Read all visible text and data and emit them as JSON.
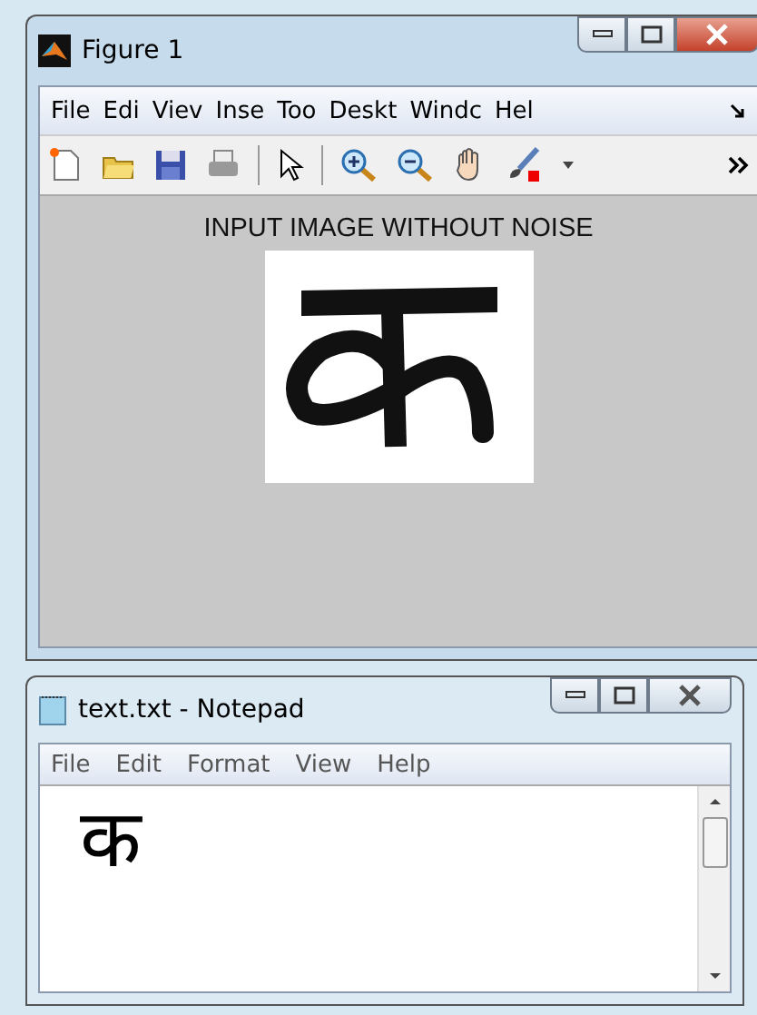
{
  "figure_window": {
    "title": "Figure 1",
    "active": true,
    "menu": [
      "File",
      "Edi",
      "Viev",
      "Inse",
      "Too",
      "Deskt",
      "Windc",
      "Hel"
    ],
    "toolbar": [
      {
        "kind": "new"
      },
      {
        "kind": "open"
      },
      {
        "kind": "save"
      },
      {
        "kind": "print"
      },
      {
        "kind": "sep"
      },
      {
        "kind": "pointer"
      },
      {
        "kind": "sep"
      },
      {
        "kind": "zoom-in"
      },
      {
        "kind": "zoom-out"
      },
      {
        "kind": "pan"
      },
      {
        "kind": "brush"
      },
      {
        "kind": "dropdown"
      }
    ],
    "axes_title": "INPUT IMAGE WITHOUT NOISE"
  },
  "notepad_window": {
    "title": "text.txt - Notepad",
    "active": false,
    "menu": [
      "File",
      "Edit",
      "Format",
      "View",
      "Help"
    ],
    "content": "क"
  }
}
